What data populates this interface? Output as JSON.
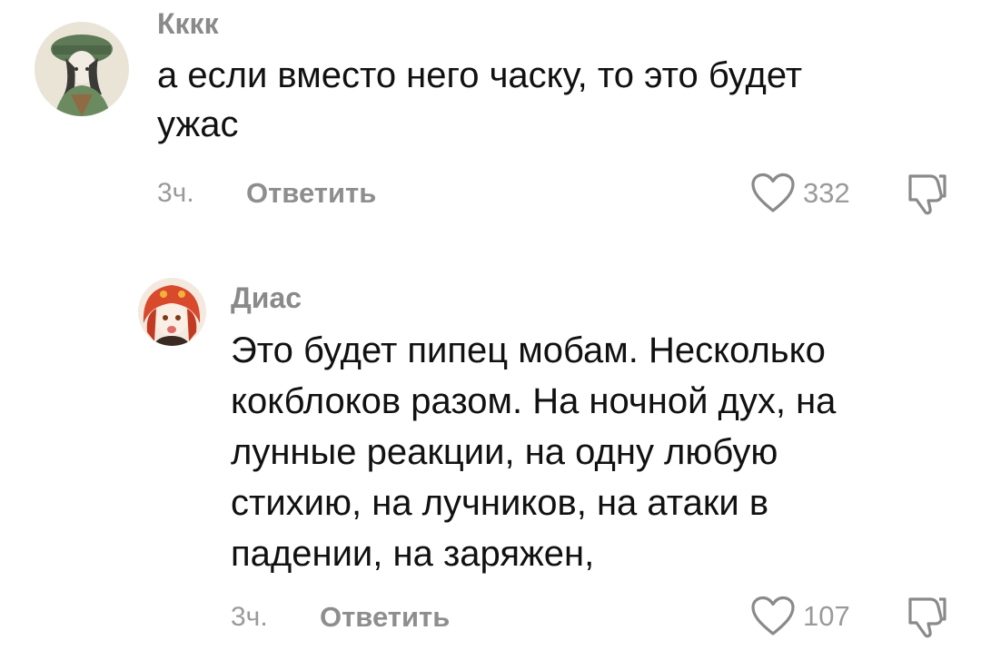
{
  "comments": [
    {
      "author": "Кккк",
      "text_lines": [
        "а если вместо него часку, то это будет",
        "ужас"
      ],
      "time": "3ч.",
      "reply_label": "Ответить",
      "likes": "332",
      "avatar_icon": "avatar-green-hat-character"
    },
    {
      "author": "Диас",
      "text_lines": [
        "Это будет пипец мобам. Несколько",
        "кокблоков разом. На ночной дух, на",
        "лунные реакции, на одну любую",
        "стихию, на лучников, на атаки в",
        "падении, на заряжен,"
      ],
      "time": "3ч.",
      "reply_label": "Ответить",
      "likes": "107",
      "avatar_icon": "avatar-red-hair-character"
    }
  ],
  "colors": {
    "text": "#111111",
    "secondary": "#8e8e8e",
    "icon_stroke": "#8a8a8a"
  }
}
